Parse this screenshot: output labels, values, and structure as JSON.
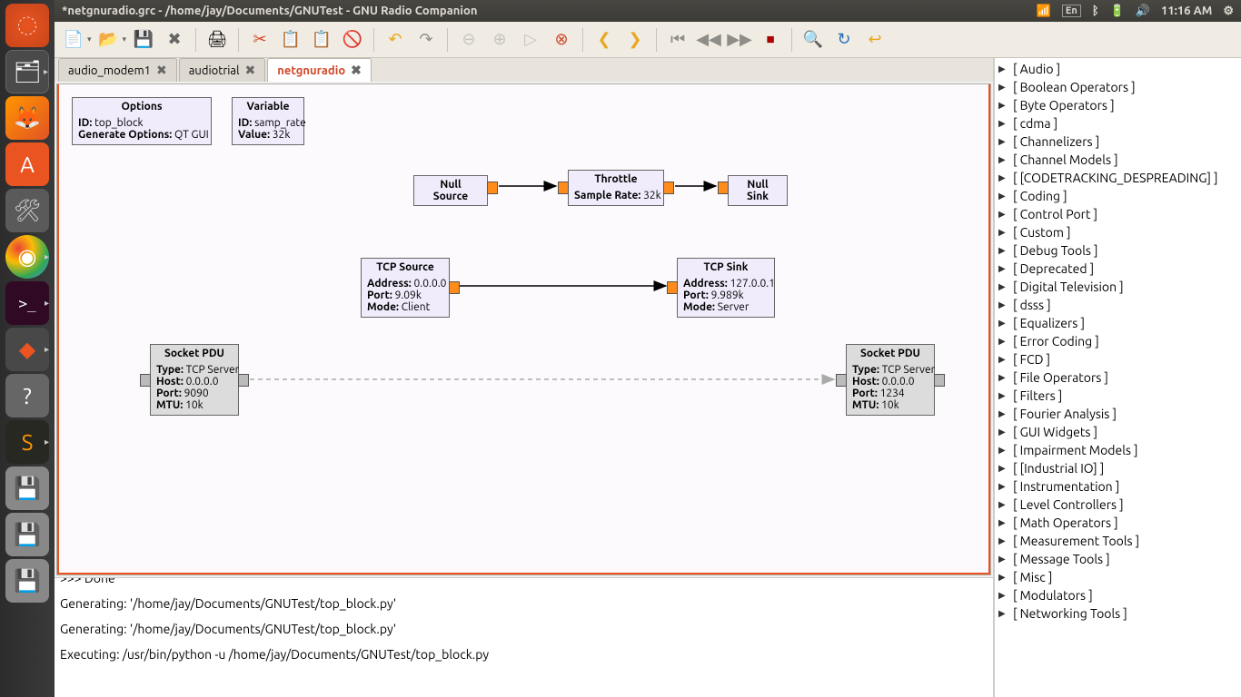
{
  "titlebar": {
    "title": "*netgnuradio.grc - /home/jay/Documents/GNUTest - GNU Radio Companion",
    "lang": "En",
    "time": "11:16 AM"
  },
  "tabs": [
    {
      "label": "audio_modem1",
      "active": false
    },
    {
      "label": "audiotrial",
      "active": false
    },
    {
      "label": "netgnuradio",
      "active": true
    }
  ],
  "blocks": {
    "options": {
      "title": "Options",
      "id_label": "ID:",
      "id": "top_block",
      "gen_label": "Generate Options:",
      "gen": "QT GUI"
    },
    "variable": {
      "title": "Variable",
      "id_label": "ID:",
      "id": "samp_rate",
      "val_label": "Value:",
      "val": "32k"
    },
    "nullsrc": {
      "title": "Null Source"
    },
    "throttle": {
      "title": "Throttle",
      "sr_label": "Sample Rate:",
      "sr": "32k"
    },
    "nullsink": {
      "title": "Null Sink"
    },
    "tcpsrc": {
      "title": "TCP Source",
      "addr_label": "Address:",
      "addr": "0.0.0.0",
      "port_label": "Port:",
      "port": "9.09k",
      "mode_label": "Mode:",
      "mode": "Client"
    },
    "tcpsink": {
      "title": "TCP Sink",
      "addr_label": "Address:",
      "addr": "127.0.0.1",
      "port_label": "Port:",
      "port": "9.989k",
      "mode_label": "Mode:",
      "mode": "Server"
    },
    "pdu1": {
      "title": "Socket PDU",
      "type_label": "Type:",
      "type": "TCP Server",
      "host_label": "Host:",
      "host": "0.0.0.0",
      "port_label": "Port:",
      "port": "9090",
      "mtu_label": "MTU:",
      "mtu": "10k"
    },
    "pdu2": {
      "title": "Socket PDU",
      "type_label": "Type:",
      "type": "TCP Server",
      "host_label": "Host:",
      "host": "0.0.0.0",
      "port_label": "Port:",
      "port": "1234",
      "mtu_label": "MTU:",
      "mtu": "10k"
    }
  },
  "console": {
    "l0": ">>> Done",
    "l1": "Generating: '/home/jay/Documents/GNUTest/top_block.py'",
    "l2": "Generating: '/home/jay/Documents/GNUTest/top_block.py'",
    "l3": "Executing: /usr/bin/python -u /home/jay/Documents/GNUTest/top_block.py"
  },
  "tree": [
    "[ Audio ]",
    "[ Boolean Operators ]",
    "[ Byte Operators ]",
    "[ cdma ]",
    "[ Channelizers ]",
    "[ Channel Models ]",
    "[ [CODETRACKING_DESPREADING] ]",
    "[ Coding ]",
    "[ Control Port ]",
    "[ Custom ]",
    "[ Debug Tools ]",
    "[ Deprecated ]",
    "[ Digital Television ]",
    "[ dsss ]",
    "[ Equalizers ]",
    "[ Error Coding ]",
    "[ FCD ]",
    "[ File Operators ]",
    "[ Filters ]",
    "[ Fourier Analysis ]",
    "[ GUI Widgets ]",
    "[ Impairment Models ]",
    "[ [Industrial IO] ]",
    "[ Instrumentation ]",
    "[ Level Controllers ]",
    "[ Math Operators ]",
    "[ Measurement Tools ]",
    "[ Message Tools ]",
    "[ Misc ]",
    "[ Modulators ]",
    "[ Networking Tools ]"
  ]
}
